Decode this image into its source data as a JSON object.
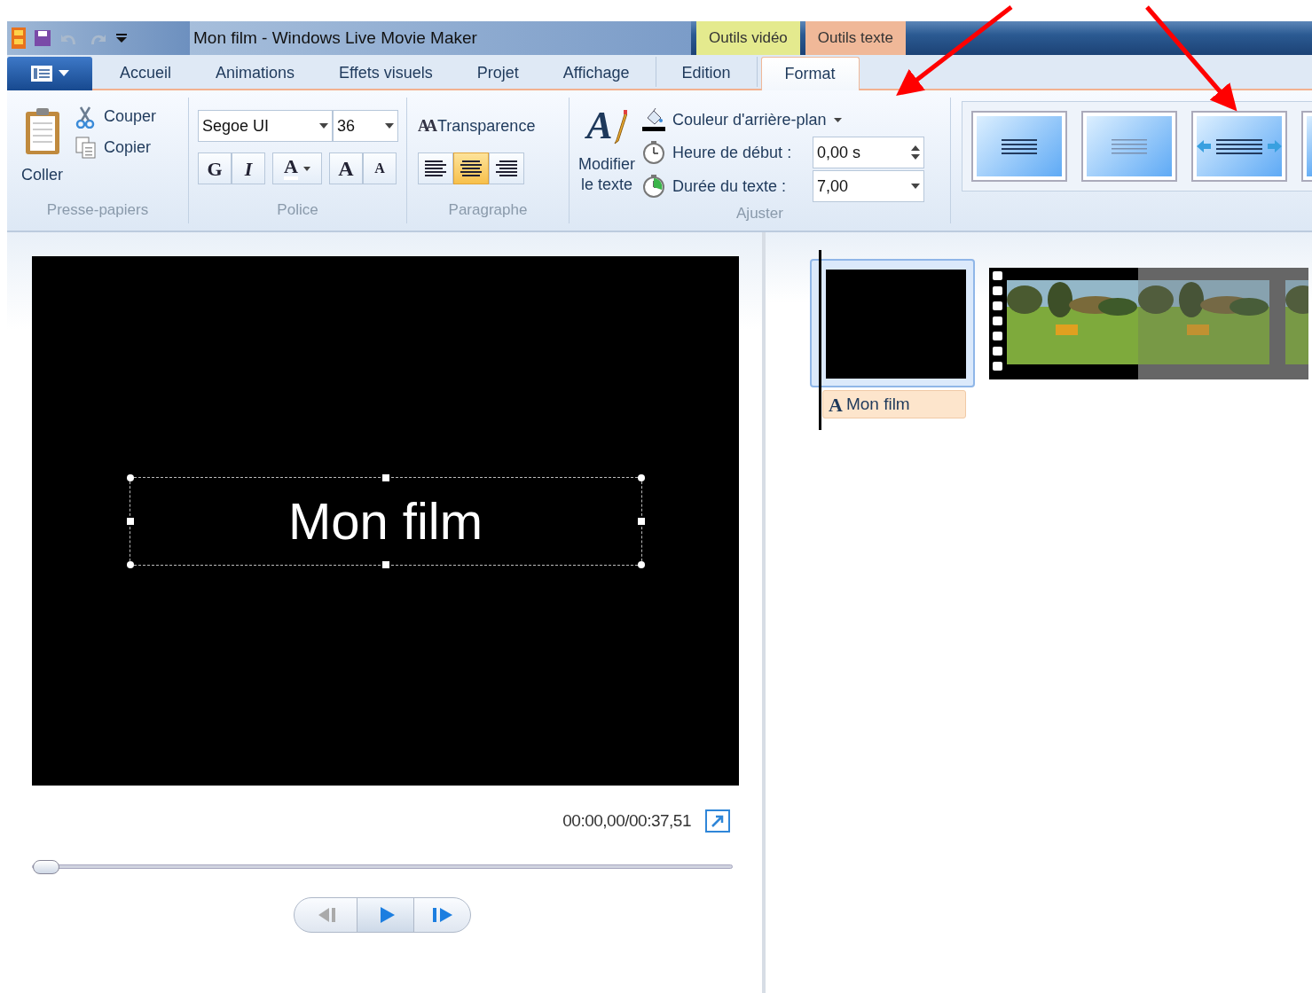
{
  "title_bar": {
    "title": "Mon film - Windows Live Movie Maker",
    "context_tabs": [
      {
        "label": "Outils vidéo",
        "color": "#e4ea8e"
      },
      {
        "label": "Outils texte",
        "color": "#f0b898"
      }
    ]
  },
  "tabs": [
    {
      "label": "Accueil",
      "selected": false
    },
    {
      "label": "Animations",
      "selected": false
    },
    {
      "label": "Effets visuels",
      "selected": false
    },
    {
      "label": "Projet",
      "selected": false
    },
    {
      "label": "Affichage",
      "selected": false
    },
    {
      "label": "Edition",
      "selected": false
    },
    {
      "label": "Format",
      "selected": true
    }
  ],
  "clipboard": {
    "label": "Presse-papiers",
    "paste": "Coller",
    "cut": "Couper",
    "copy": "Copier"
  },
  "font": {
    "label": "Police",
    "family": "Segoe UI",
    "size": "36",
    "bold": "G",
    "italic": "I",
    "color_glyph": "A",
    "grow_glyph": "A",
    "shrink_glyph": "A"
  },
  "paragraph": {
    "label": "Paragraphe",
    "transparency_glyph": "AA",
    "transparency": "Transparence",
    "alignments": [
      {
        "kind": "left",
        "selected": false
      },
      {
        "kind": "center",
        "selected": true
      },
      {
        "kind": "right",
        "selected": false
      }
    ]
  },
  "adjust": {
    "label": "Ajuster",
    "edit_glyph": "A",
    "edit_lines": [
      "Modifier",
      "le texte"
    ],
    "background_color": "Couleur d'arrière-plan",
    "start_label": "Heure de début :",
    "start_value": "0,00 s",
    "duration_label": "Durée du texte :",
    "duration_value": "7,00"
  },
  "effects": [
    {
      "kind": "lines"
    },
    {
      "kind": "faded"
    },
    {
      "kind": "arrows"
    },
    {
      "kind": "partial"
    }
  ],
  "preview": {
    "overlay_text": "Mon film",
    "time": "00:00,00/00:37,51",
    "seek": {
      "level": 0
    }
  },
  "storyboard": [
    {
      "kind": "title",
      "glyph": "A",
      "label": "Mon film",
      "selected": true
    },
    {
      "kind": "video"
    }
  ]
}
